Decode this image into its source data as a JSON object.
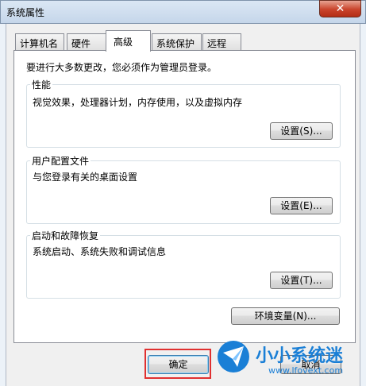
{
  "window": {
    "title": "系统属性",
    "close_label": "✕"
  },
  "tabs": [
    {
      "label": "计算机名"
    },
    {
      "label": "硬件"
    },
    {
      "label": "高级"
    },
    {
      "label": "系统保护"
    },
    {
      "label": "远程"
    }
  ],
  "notice": "要进行大多数更改，您必须作为管理员登录。",
  "performance": {
    "title": "性能",
    "desc": "视觉效果，处理器计划，内存使用，以及虚拟内存",
    "button": "设置(S)..."
  },
  "user_profiles": {
    "title": "用户配置文件",
    "desc": "与您登录有关的桌面设置",
    "button": "设置(E)..."
  },
  "startup": {
    "title": "启动和故障恢复",
    "desc": "系统启动、系统失败和调试信息",
    "button": "设置(T)..."
  },
  "env_button": "环境变量(N)...",
  "footer": {
    "ok": "确定",
    "cancel": "取消"
  },
  "watermark": {
    "text": "小小系统迷",
    "url": "www.lfovext.com"
  }
}
